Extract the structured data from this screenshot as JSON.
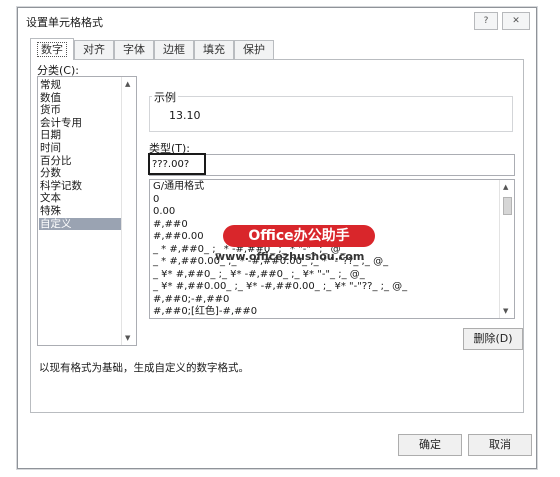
{
  "window": {
    "title": "设置单元格格式",
    "help_label": "?",
    "close_label": "✕"
  },
  "tabs": [
    {
      "label": "数字",
      "active": true
    },
    {
      "label": "对齐",
      "active": false
    },
    {
      "label": "字体",
      "active": false
    },
    {
      "label": "边框",
      "active": false
    },
    {
      "label": "填充",
      "active": false
    },
    {
      "label": "保护",
      "active": false
    }
  ],
  "category": {
    "label": "分类(C):",
    "items": [
      "常规",
      "数值",
      "货币",
      "会计专用",
      "日期",
      "时间",
      "百分比",
      "分数",
      "科学记数",
      "文本",
      "特殊",
      "自定义"
    ],
    "selected": "自定义"
  },
  "sample": {
    "label": "示例",
    "value": "13.10"
  },
  "type": {
    "label": "类型(T):",
    "value": "???.00?"
  },
  "formats": [
    "G/通用格式",
    "0",
    "0.00",
    "#,##0",
    "#,##0.00",
    "_ * #,##0_ ;_ * -#,##0_ ;_ * \"-\"_ ;_ @_",
    "_ * #,##0.00_ ;_ * -#,##0.00_ ;_ * \"-\"??_ ;_ @_",
    "_ ¥* #,##0_ ;_ ¥* -#,##0_ ;_ ¥* \"-\"_ ;_ @_",
    "_ ¥* #,##0.00_ ;_ ¥* -#,##0.00_ ;_ ¥* \"-\"??_ ;_ @_",
    "#,##0;-#,##0",
    "#,##0;[红色]-#,##0"
  ],
  "delete_label": "删除(D)",
  "description": "以现有格式为基础，生成自定义的数字格式。",
  "ok_label": "确定",
  "cancel_label": "取消",
  "watermark": {
    "badge": "Office办公助手",
    "url": "www.officezhushou.com"
  },
  "colors": {
    "border": "#8f9399",
    "selection": "#9aa3b2",
    "watermark_red": "#d9262b"
  }
}
